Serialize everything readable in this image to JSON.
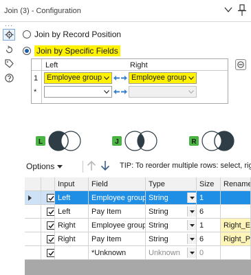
{
  "window": {
    "title": "Join (3) - Configuration"
  },
  "toolstrip": {
    "dots": "···",
    "icons": [
      "gear-icon",
      "rotate-icon",
      "tag-icon",
      "help-icon"
    ]
  },
  "join_mode": {
    "by_position_label": "Join by Record Position",
    "by_fields_label": "Join by Specific Fields",
    "selected": "by_fields"
  },
  "join_fields": {
    "left_header": "Left",
    "right_header": "Right",
    "rows": [
      {
        "num": "1",
        "left": "Employee group",
        "right": "Employee group"
      },
      {
        "num": "*",
        "left": "",
        "right": ""
      }
    ]
  },
  "venn": {
    "left_badge": "L",
    "join_badge": "J",
    "right_badge": "R"
  },
  "options_bar": {
    "options_label": "Options",
    "tip": "TIP: To reorder multiple rows: select, right-click"
  },
  "grid": {
    "columns": [
      "Input",
      "Field",
      "Type",
      "Size",
      "Rename"
    ],
    "rows": [
      {
        "input": "Left",
        "field": "Employee group",
        "type": "String",
        "size": "1",
        "rename": "",
        "checked": true,
        "selected": true
      },
      {
        "input": "Left",
        "field": "Pay Item",
        "type": "String",
        "size": "6",
        "rename": "",
        "checked": true,
        "selected": false
      },
      {
        "input": "Right",
        "field": "Employee group",
        "type": "String",
        "size": "1",
        "rename": "Right_E",
        "checked": true,
        "selected": false
      },
      {
        "input": "Right",
        "field": "Pay Item",
        "type": "String",
        "size": "6",
        "rename": "Right_P",
        "checked": true,
        "selected": false
      },
      {
        "input": "",
        "field": "*Unknown",
        "type": "Unknown",
        "size": "0",
        "rename": "",
        "checked": true,
        "selected": false
      }
    ]
  },
  "colors": {
    "highlight": "#fff200",
    "selection": "#1f8fe6",
    "badge_green": "#4bb543"
  }
}
